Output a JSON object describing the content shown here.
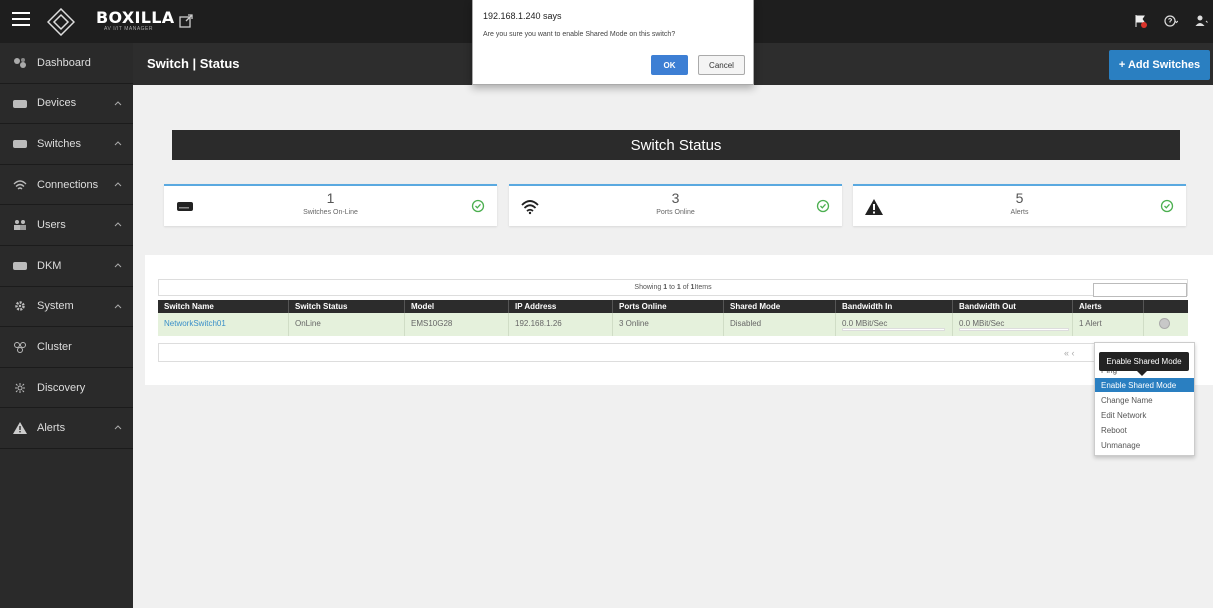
{
  "topbar": {
    "brand_name": "BOXILLA",
    "brand_sub": "AV I/IT MANAGER"
  },
  "sidebar": {
    "items": [
      {
        "label": "Dashboard",
        "icon": "dashboard-icon",
        "expandable": false
      },
      {
        "label": "Devices",
        "icon": "device-icon",
        "expandable": true
      },
      {
        "label": "Switches",
        "icon": "switch-icon",
        "expandable": true
      },
      {
        "label": "Connections",
        "icon": "wifi-icon",
        "expandable": true
      },
      {
        "label": "Users",
        "icon": "users-icon",
        "expandable": true
      },
      {
        "label": "DKM",
        "icon": "dkm-icon",
        "expandable": true
      },
      {
        "label": "System",
        "icon": "gear-icon",
        "expandable": true
      },
      {
        "label": "Cluster",
        "icon": "cluster-icon",
        "expandable": false
      },
      {
        "label": "Discovery",
        "icon": "discovery-icon",
        "expandable": false
      },
      {
        "label": "Alerts",
        "icon": "alert-icon",
        "expandable": true
      }
    ]
  },
  "header": {
    "title": "Switch | Status",
    "add_button": "+ Add Switches"
  },
  "main": {
    "banner": "Switch Status",
    "cards": [
      {
        "value": "1",
        "label": "Switches On-Line",
        "icon": "switch-icon"
      },
      {
        "value": "3",
        "label": "Ports Online",
        "icon": "wifi-icon"
      },
      {
        "value": "5",
        "label": "Alerts",
        "icon": "warning-icon"
      }
    ]
  },
  "table": {
    "showing_prefix": "Showing ",
    "showing_from": "1",
    "showing_mid": " to ",
    "showing_to": "1",
    "showing_of": " of ",
    "showing_total": "1",
    "showing_suffix": " Items",
    "columns": [
      "Switch Name",
      "Switch Status",
      "Model",
      "IP Address",
      "Ports Online",
      "Shared Mode",
      "Bandwidth In",
      "Bandwidth Out",
      "Alerts"
    ],
    "rows": [
      [
        "NetworkSwitch01",
        "OnLine",
        "EMS10G28",
        "192.168.1.26",
        "3 Online",
        "Disabled",
        "0.0 MBit/Sec",
        "0.0 MBit/Sec",
        "1 Alert"
      ]
    ],
    "pager": "«  ‹"
  },
  "dropdown": {
    "tooltip": "Enable Shared Mode",
    "items": [
      "Ping",
      "Enable Shared Mode",
      "Change Name",
      "Edit Network",
      "Reboot",
      "Unmanage"
    ],
    "active_index": 1
  },
  "dialog": {
    "title": "192.168.1.240 says",
    "message": "Are you sure you want to enable Shared Mode on this switch?",
    "ok": "OK",
    "cancel": "Cancel"
  },
  "colors": {
    "accent": "#2a7fc1",
    "ok_green": "#4caf50",
    "row_bg": "#e5f1dc"
  }
}
